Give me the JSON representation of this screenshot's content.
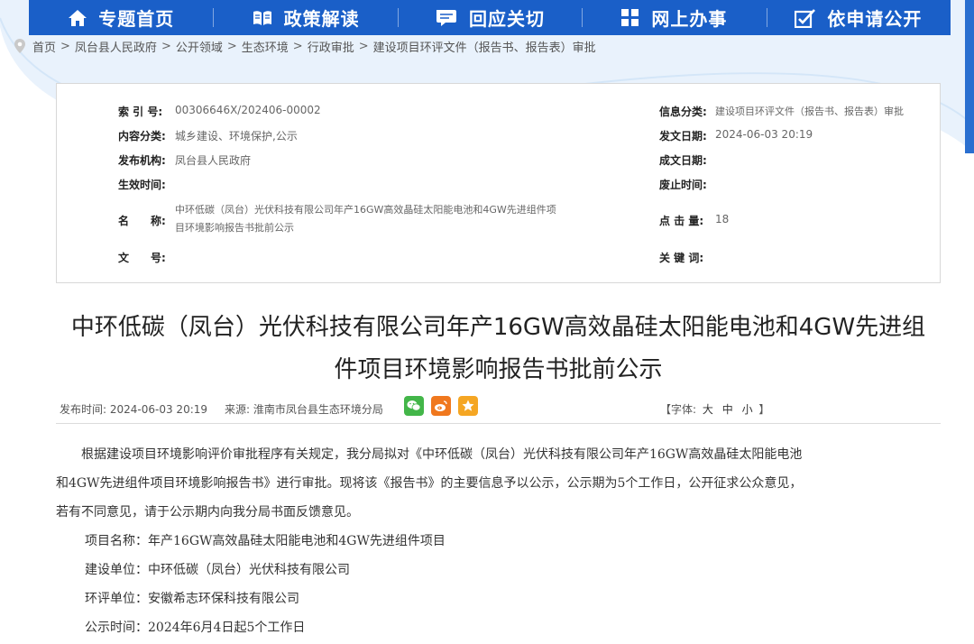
{
  "nav": [
    {
      "label": "专题首页",
      "icon": "home-icon"
    },
    {
      "label": "政策解读",
      "icon": "book-icon"
    },
    {
      "label": "回应关切",
      "icon": "chat-icon"
    },
    {
      "label": "网上办事",
      "icon": "grid-icon"
    },
    {
      "label": "依申请公开",
      "icon": "checkbox-icon"
    }
  ],
  "breadcrumb": [
    "首页",
    "凤台县人民政府",
    "公开领域",
    "生态环境",
    "行政审批",
    "建设项目环评文件（报告书、报告表）审批"
  ],
  "meta": {
    "index_label": "索 引 号:",
    "index_value": "00306646X/202406-00002",
    "category_label": "信息分类:",
    "category_value": "建设项目环评文件（报告书、报告表）审批",
    "content_label": "内容分类:",
    "content_value": "城乡建设、环境保护,公示",
    "date_label": "发文日期:",
    "date_value": "2024-06-03 20:19",
    "org_label": "发布机构:",
    "org_value": "凤台县人民政府",
    "made_label": "成文日期:",
    "made_value": "",
    "effective_label": "生效时间:",
    "effective_value": "",
    "expire_label": "废止时间:",
    "expire_value": "",
    "name_label": "名　　称:",
    "name_value_line1": "中环低碳（凤台）光伏科技有限公司年产16GW高效晶硅太阳能电池和4GW先进组件项",
    "name_value_line2": "目环境影响报告书批前公示",
    "hits_label": "点 击 量:",
    "hits_value": "18",
    "docno_label": "文　　号:",
    "docno_value": "",
    "keywords_label": "关 键 词:",
    "keywords_value": ""
  },
  "title_line1": "中环低碳（凤台）光伏科技有限公司年产16GW高效晶硅太阳能电池和4GW先进组",
  "title_line2": "件项目环境影响报告书批前公示",
  "info": {
    "pub_label": "发布时间:",
    "pub_value": "2024-06-03 20:19",
    "src_label": "来源:",
    "src_value": "淮南市凤台县生态环境分局",
    "fontsize_label": "【字体:",
    "fontsize_large": "大",
    "fontsize_medium": "中",
    "fontsize_small": "小",
    "fontsize_close": "】"
  },
  "body": {
    "para1_line1": "根据建设项目环境影响评价审批程序有关规定，我分局拟对《中环低碳（凤台）光伏科技有限公司年产16GW高效晶硅太阳能电池",
    "para1_line2": "和4GW先进组件项目环境影响报告书》进行审批。现将该《报告书》的主要信息予以公示，公示期为5个工作日，公开征求公众意见，",
    "para1_line3": "若有不同意见，请于公示期内向我分局书面反馈意见。",
    "project": "项目名称：年产16GW高效晶硅太阳能电池和4GW先进组件项目",
    "builder": "建设单位：中环低碳（凤台）光伏科技有限公司",
    "eia_unit": "环评单位：安徽希志环保科技有限公司",
    "period": "公示时间：2024年6月4日起5个工作日"
  },
  "colors": {
    "nav_bg": "#1a5fc8",
    "wechat": "#43b649",
    "weibo": "#f0781e",
    "favorite": "#f5a623"
  }
}
